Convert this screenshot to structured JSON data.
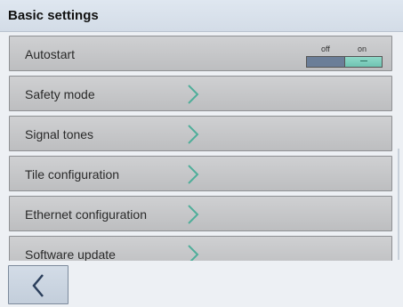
{
  "header": {
    "title": "Basic settings"
  },
  "settings": {
    "rows": [
      {
        "label": "Autostart",
        "type": "toggle",
        "toggle": {
          "off_label": "off",
          "on_label": "on",
          "state": "on"
        }
      },
      {
        "label": "Safety mode",
        "type": "nav",
        "icon": "chevron-right-icon"
      },
      {
        "label": "Signal tones",
        "type": "nav",
        "icon": "chevron-right-icon"
      },
      {
        "label": "Tile configuration",
        "type": "nav",
        "icon": "chevron-right-icon"
      },
      {
        "label": "Ethernet configuration",
        "type": "nav",
        "icon": "chevron-right-icon"
      },
      {
        "label": "Software update",
        "type": "nav",
        "icon": "chevron-right-icon"
      }
    ]
  },
  "footer": {
    "back_icon": "chevron-left-icon"
  },
  "colors": {
    "accent": "#4fae9a",
    "toggle_on": "#7fd2c0",
    "toggle_off": "#6b7e98"
  }
}
